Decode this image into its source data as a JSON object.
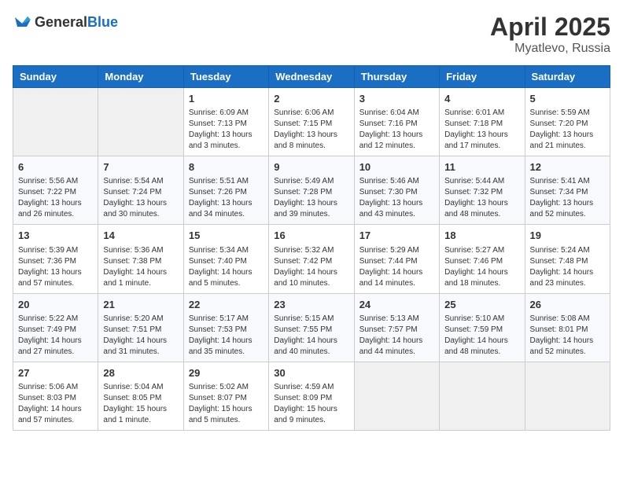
{
  "header": {
    "logo_general": "General",
    "logo_blue": "Blue",
    "title": "April 2025",
    "location": "Myatlevo, Russia"
  },
  "weekdays": [
    "Sunday",
    "Monday",
    "Tuesday",
    "Wednesday",
    "Thursday",
    "Friday",
    "Saturday"
  ],
  "weeks": [
    [
      {
        "day": "",
        "info": ""
      },
      {
        "day": "",
        "info": ""
      },
      {
        "day": "1",
        "info": "Sunrise: 6:09 AM\nSunset: 7:13 PM\nDaylight: 13 hours and 3 minutes."
      },
      {
        "day": "2",
        "info": "Sunrise: 6:06 AM\nSunset: 7:15 PM\nDaylight: 13 hours and 8 minutes."
      },
      {
        "day": "3",
        "info": "Sunrise: 6:04 AM\nSunset: 7:16 PM\nDaylight: 13 hours and 12 minutes."
      },
      {
        "day": "4",
        "info": "Sunrise: 6:01 AM\nSunset: 7:18 PM\nDaylight: 13 hours and 17 minutes."
      },
      {
        "day": "5",
        "info": "Sunrise: 5:59 AM\nSunset: 7:20 PM\nDaylight: 13 hours and 21 minutes."
      }
    ],
    [
      {
        "day": "6",
        "info": "Sunrise: 5:56 AM\nSunset: 7:22 PM\nDaylight: 13 hours and 26 minutes."
      },
      {
        "day": "7",
        "info": "Sunrise: 5:54 AM\nSunset: 7:24 PM\nDaylight: 13 hours and 30 minutes."
      },
      {
        "day": "8",
        "info": "Sunrise: 5:51 AM\nSunset: 7:26 PM\nDaylight: 13 hours and 34 minutes."
      },
      {
        "day": "9",
        "info": "Sunrise: 5:49 AM\nSunset: 7:28 PM\nDaylight: 13 hours and 39 minutes."
      },
      {
        "day": "10",
        "info": "Sunrise: 5:46 AM\nSunset: 7:30 PM\nDaylight: 13 hours and 43 minutes."
      },
      {
        "day": "11",
        "info": "Sunrise: 5:44 AM\nSunset: 7:32 PM\nDaylight: 13 hours and 48 minutes."
      },
      {
        "day": "12",
        "info": "Sunrise: 5:41 AM\nSunset: 7:34 PM\nDaylight: 13 hours and 52 minutes."
      }
    ],
    [
      {
        "day": "13",
        "info": "Sunrise: 5:39 AM\nSunset: 7:36 PM\nDaylight: 13 hours and 57 minutes."
      },
      {
        "day": "14",
        "info": "Sunrise: 5:36 AM\nSunset: 7:38 PM\nDaylight: 14 hours and 1 minute."
      },
      {
        "day": "15",
        "info": "Sunrise: 5:34 AM\nSunset: 7:40 PM\nDaylight: 14 hours and 5 minutes."
      },
      {
        "day": "16",
        "info": "Sunrise: 5:32 AM\nSunset: 7:42 PM\nDaylight: 14 hours and 10 minutes."
      },
      {
        "day": "17",
        "info": "Sunrise: 5:29 AM\nSunset: 7:44 PM\nDaylight: 14 hours and 14 minutes."
      },
      {
        "day": "18",
        "info": "Sunrise: 5:27 AM\nSunset: 7:46 PM\nDaylight: 14 hours and 18 minutes."
      },
      {
        "day": "19",
        "info": "Sunrise: 5:24 AM\nSunset: 7:48 PM\nDaylight: 14 hours and 23 minutes."
      }
    ],
    [
      {
        "day": "20",
        "info": "Sunrise: 5:22 AM\nSunset: 7:49 PM\nDaylight: 14 hours and 27 minutes."
      },
      {
        "day": "21",
        "info": "Sunrise: 5:20 AM\nSunset: 7:51 PM\nDaylight: 14 hours and 31 minutes."
      },
      {
        "day": "22",
        "info": "Sunrise: 5:17 AM\nSunset: 7:53 PM\nDaylight: 14 hours and 35 minutes."
      },
      {
        "day": "23",
        "info": "Sunrise: 5:15 AM\nSunset: 7:55 PM\nDaylight: 14 hours and 40 minutes."
      },
      {
        "day": "24",
        "info": "Sunrise: 5:13 AM\nSunset: 7:57 PM\nDaylight: 14 hours and 44 minutes."
      },
      {
        "day": "25",
        "info": "Sunrise: 5:10 AM\nSunset: 7:59 PM\nDaylight: 14 hours and 48 minutes."
      },
      {
        "day": "26",
        "info": "Sunrise: 5:08 AM\nSunset: 8:01 PM\nDaylight: 14 hours and 52 minutes."
      }
    ],
    [
      {
        "day": "27",
        "info": "Sunrise: 5:06 AM\nSunset: 8:03 PM\nDaylight: 14 hours and 57 minutes."
      },
      {
        "day": "28",
        "info": "Sunrise: 5:04 AM\nSunset: 8:05 PM\nDaylight: 15 hours and 1 minute."
      },
      {
        "day": "29",
        "info": "Sunrise: 5:02 AM\nSunset: 8:07 PM\nDaylight: 15 hours and 5 minutes."
      },
      {
        "day": "30",
        "info": "Sunrise: 4:59 AM\nSunset: 8:09 PM\nDaylight: 15 hours and 9 minutes."
      },
      {
        "day": "",
        "info": ""
      },
      {
        "day": "",
        "info": ""
      },
      {
        "day": "",
        "info": ""
      }
    ]
  ]
}
